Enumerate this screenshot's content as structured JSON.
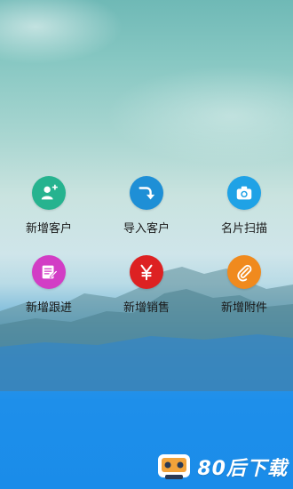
{
  "actions": [
    {
      "label": "新增客户",
      "icon": "add-user-icon",
      "color": "#26b38f"
    },
    {
      "label": "导入客户",
      "icon": "import-arrow-icon",
      "color": "#1e8fd6"
    },
    {
      "label": "名片扫描",
      "icon": "camera-icon",
      "color": "#1fa2e6"
    },
    {
      "label": "新增跟进",
      "icon": "edit-note-icon",
      "color": "#d23dc5"
    },
    {
      "label": "新增销售",
      "icon": "yen-icon",
      "color": "#dd2122"
    },
    {
      "label": "新增附件",
      "icon": "paperclip-icon",
      "color": "#f08a1e"
    }
  ],
  "watermark": {
    "text": "80后下载"
  }
}
